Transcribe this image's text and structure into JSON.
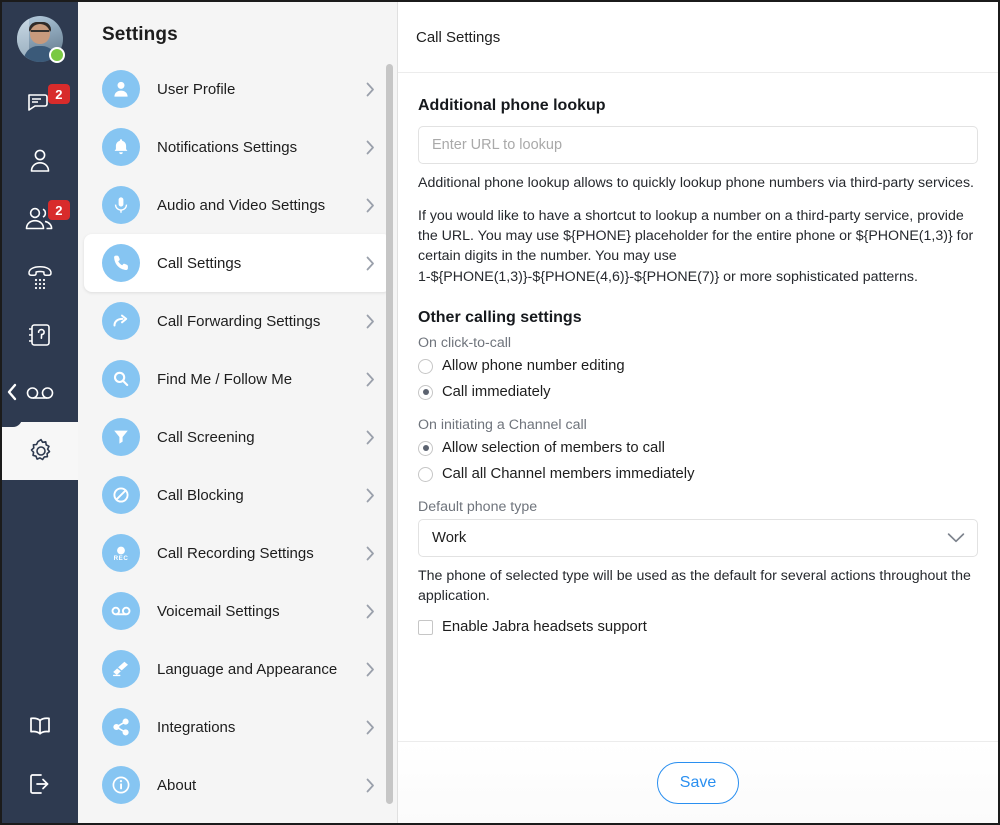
{
  "rail": {
    "avatar_name": "user-avatar",
    "presence": "online",
    "items": [
      {
        "icon": "chat-icon",
        "badge": "2"
      },
      {
        "icon": "contact-person-icon",
        "badge": ""
      },
      {
        "icon": "contacts-group-icon",
        "badge": "2"
      },
      {
        "icon": "dialpad-phone-icon",
        "badge": ""
      },
      {
        "icon": "phonebook-icon",
        "badge": ""
      },
      {
        "icon": "voicemail-icon",
        "badge": ""
      },
      {
        "icon": "gear-icon",
        "badge": ""
      }
    ],
    "bottom_items": [
      {
        "icon": "book-icon"
      },
      {
        "icon": "logout-icon"
      }
    ],
    "collapse_icon": "chevron-left-icon"
  },
  "settings": {
    "title": "Settings",
    "items": [
      {
        "label": "User Profile",
        "icon": "user-icon",
        "active": false
      },
      {
        "label": "Notifications Settings",
        "icon": "bell-icon",
        "active": false
      },
      {
        "label": "Audio and Video Settings",
        "icon": "microphone-icon",
        "active": false
      },
      {
        "label": "Call Settings",
        "icon": "phone-icon",
        "active": true
      },
      {
        "label": "Call Forwarding Settings",
        "icon": "arrow-forward-icon",
        "active": false
      },
      {
        "label": "Find Me / Follow Me",
        "icon": "search-icon",
        "active": false
      },
      {
        "label": "Call Screening",
        "icon": "funnel-icon",
        "active": false
      },
      {
        "label": "Call Blocking",
        "icon": "block-icon",
        "active": false
      },
      {
        "label": "Call Recording Settings",
        "icon": "record-icon",
        "active": false
      },
      {
        "label": "Voicemail Settings",
        "icon": "voicemail-icon",
        "active": false
      },
      {
        "label": "Language and Appearance",
        "icon": "brush-icon",
        "active": false
      },
      {
        "label": "Integrations",
        "icon": "share-icon",
        "active": false
      },
      {
        "label": "About",
        "icon": "info-icon",
        "active": false
      }
    ],
    "chevron_icon": "chevron-right-icon"
  },
  "content": {
    "header_title": "Call Settings",
    "lookup": {
      "section_title": "Additional phone lookup",
      "input_value": "",
      "input_placeholder": "Enter URL to lookup",
      "help_1": "Additional phone lookup allows to quickly lookup phone numbers via third-party services.",
      "help_2": "If you would like to have a shortcut to lookup a number on a third-party service, provide the URL. You may use ${PHONE} placeholder for the entire phone or ${PHONE(1,3)} for certain digits in the number. You may use 1-${PHONE(1,3)}-${PHONE(4,6)}-${PHONE(7)} or more sophisticated patterns."
    },
    "other": {
      "section_title": "Other calling settings",
      "click_to_call_label": "On click-to-call",
      "click_to_call_options": [
        {
          "label": "Allow phone number editing",
          "selected": false
        },
        {
          "label": "Call immediately",
          "selected": true
        }
      ],
      "channel_call_label": "On initiating a Channel call",
      "channel_call_options": [
        {
          "label": "Allow selection of members to call",
          "selected": true
        },
        {
          "label": "Call all Channel members immediately",
          "selected": false
        }
      ],
      "phone_type_label": "Default phone type",
      "phone_type_value": "Work",
      "phone_type_caret": "chevron-down-icon",
      "phone_type_help": "The phone of selected type will be used as the default for several actions throughout the application.",
      "jabra_label": "Enable Jabra headsets support",
      "jabra_checked": false
    },
    "save_label": "Save"
  },
  "colors": {
    "rail_bg": "#2e3a50",
    "accent_blue": "#2a8ff0",
    "icon_circle": "#86c5f2",
    "badge_red": "#d82b2b",
    "presence_green": "#7ac943"
  }
}
